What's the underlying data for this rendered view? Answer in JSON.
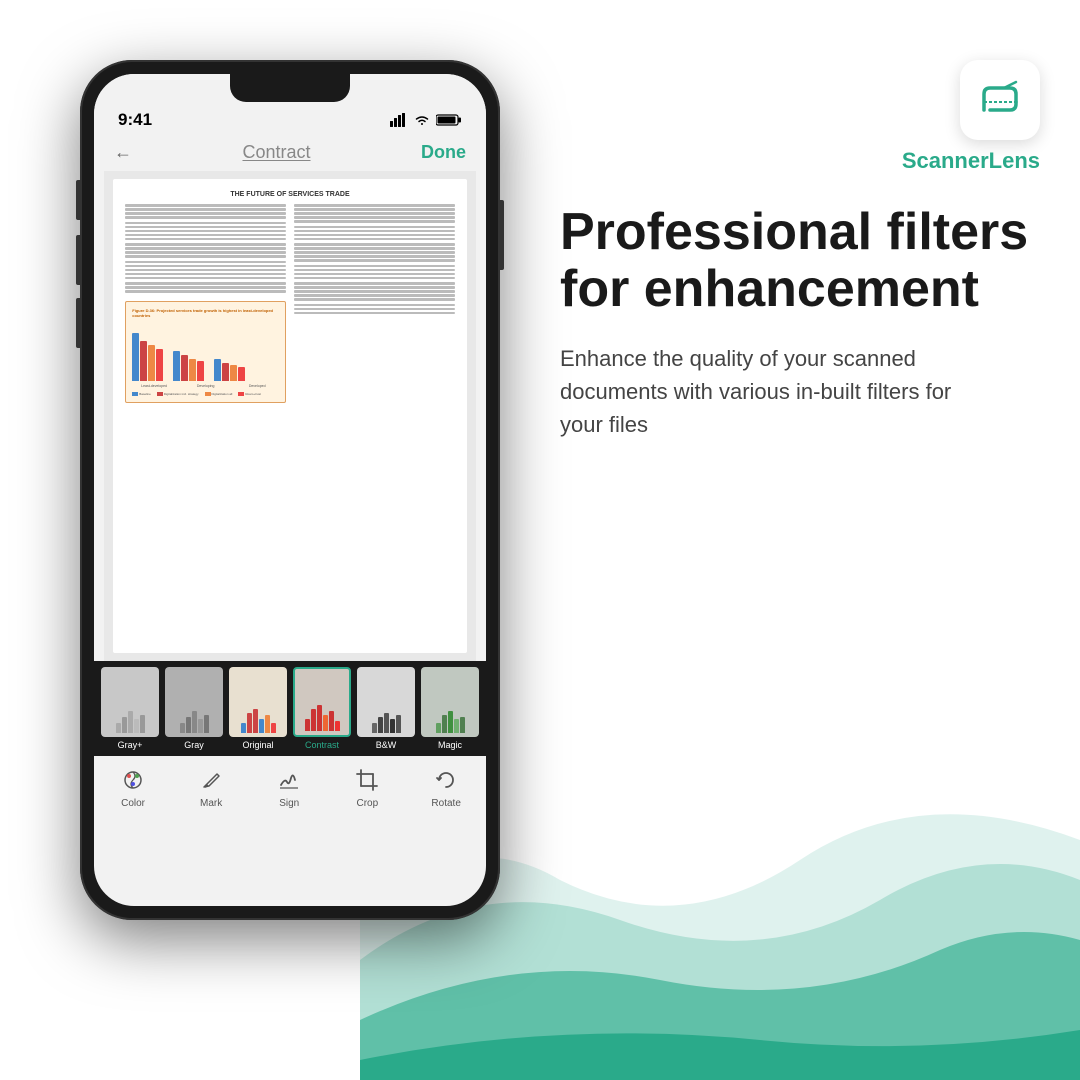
{
  "app": {
    "name_regular": "Scanner",
    "name_bold": "Lens"
  },
  "phone": {
    "status_time": "9:41",
    "nav_back": "←",
    "nav_title": "Contract",
    "nav_done": "Done",
    "doc_title": "THE FUTURE OF SERVICES TRADE",
    "chart_section_title": "Figure D.36: Projected services trade growth is highest in least-developed countries",
    "filters": [
      {
        "id": "gray-plus",
        "label": "Gray+",
        "selected": false,
        "color": "#c8c8c8",
        "bar_color": "#aaa"
      },
      {
        "id": "gray",
        "label": "Gray",
        "selected": false,
        "color": "#b8b8b8",
        "bar_color": "#999"
      },
      {
        "id": "original",
        "label": "Original",
        "selected": false,
        "color": "#e0d8c8",
        "bar_color": "#c0a080"
      },
      {
        "id": "contrast",
        "label": "Contrast",
        "selected": true,
        "color": "#ccc0b8",
        "bar_color": "#e05050"
      },
      {
        "id": "bw",
        "label": "B&W",
        "selected": false,
        "color": "#d8d8d8",
        "bar_color": "#888"
      },
      {
        "id": "magic",
        "label": "Magic",
        "selected": false,
        "color": "#c8d0c8",
        "bar_color": "#90c090"
      }
    ],
    "toolbar": [
      {
        "id": "color",
        "label": "Color",
        "icon": "color-icon"
      },
      {
        "id": "mark",
        "label": "Mark",
        "icon": "mark-icon"
      },
      {
        "id": "sign",
        "label": "Sign",
        "icon": "sign-icon"
      },
      {
        "id": "crop",
        "label": "Crop",
        "icon": "crop-icon"
      },
      {
        "id": "rotate",
        "label": "Rotate",
        "icon": "rotate-icon"
      }
    ]
  },
  "marketing": {
    "headline_line1": "Professional filters",
    "headline_line2": "for enhancement",
    "subheadline": "Enhance the quality of your scanned documents with various in-built filters for your files"
  },
  "colors": {
    "teal": "#2aaa8a",
    "dark": "#1a1a1a",
    "text_secondary": "#444"
  }
}
